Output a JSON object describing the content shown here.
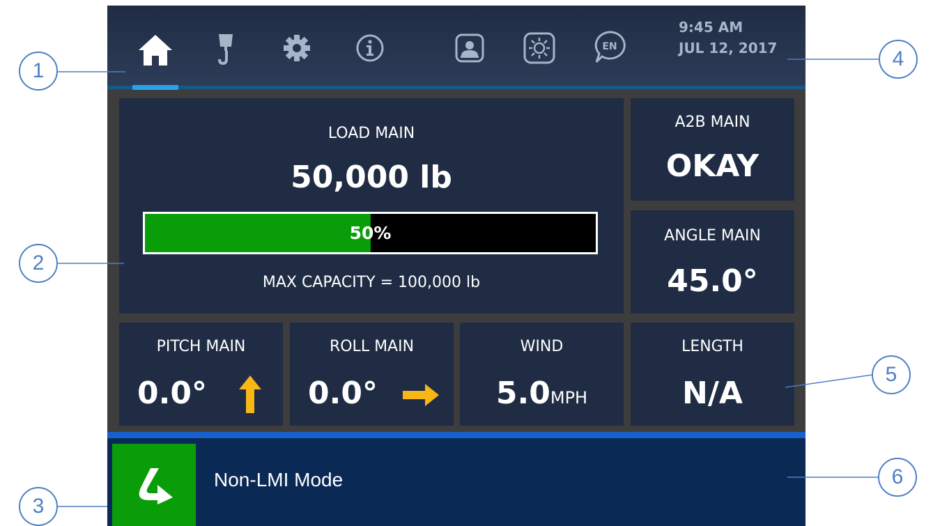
{
  "header": {
    "tabs": [
      {
        "icon": "home-icon",
        "active": true
      },
      {
        "icon": "crane-hook-icon"
      },
      {
        "icon": "gear-icon"
      },
      {
        "icon": "info-icon"
      },
      {
        "icon": "operator-profile-icon"
      },
      {
        "icon": "brightness-icon"
      },
      {
        "icon": "language-icon",
        "text": "EN"
      }
    ],
    "time": "9:45 AM",
    "date": "JUL 12, 2017"
  },
  "load": {
    "label": "LOAD MAIN",
    "value": "50,000 lb",
    "percent_label": "50%",
    "percent": 50,
    "max_capacity": "MAX CAPACITY = 100,000 lb"
  },
  "a2b": {
    "label": "A2B MAIN",
    "value": "OKAY"
  },
  "angle": {
    "label": "ANGLE MAIN",
    "value": "45.0°"
  },
  "pitch": {
    "label": "PITCH MAIN",
    "value": "0.0°",
    "arrow": "arrow-up-icon"
  },
  "roll": {
    "label": "ROLL MAIN",
    "value": "0.0°",
    "arrow": "arrow-right-icon"
  },
  "wind": {
    "label": "WIND",
    "value": "5.0",
    "unit": "MPH"
  },
  "length": {
    "label": "LENGTH",
    "value": "N/A"
  },
  "footer": {
    "mode_label": "Non-LMI Mode"
  },
  "colors": {
    "panel": "#1f2c44",
    "accent_green": "#0a9d0a",
    "arrow_amber": "#f8b617",
    "footer": "#0a2955",
    "tab_indicator": "#29a2ea",
    "callout": "#4e7fc4"
  },
  "callouts": [
    "1",
    "2",
    "3",
    "4",
    "5",
    "6"
  ]
}
